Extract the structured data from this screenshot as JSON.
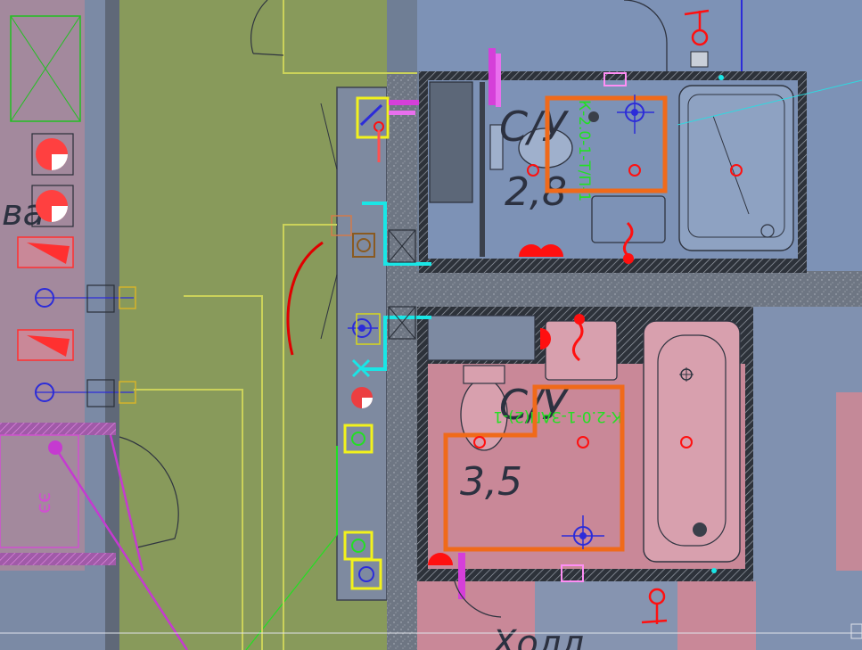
{
  "drawing": {
    "rooms": [
      {
        "id": "bath-top",
        "code": "С/У",
        "area": "2,8"
      },
      {
        "id": "bath-bottom",
        "code": "С/У",
        "area": "3,5"
      }
    ],
    "fragments": {
      "left_room": "ва",
      "left_pink": "ээ",
      "hall": "Холл"
    },
    "tags": {
      "top": "К-2.0-1-Т/П-1",
      "bottom": "К-2.0-1-ЗАП(2)-1"
    },
    "colors": {
      "background": "#6f7e95",
      "room_blue": "#7d92b6",
      "room_pink": "#c98898",
      "corridor_green": "#889a5b",
      "wall": "#3f4651",
      "highlight_orange": "#f06a1a",
      "highlight_yellow": "#f2f21c",
      "symbol_red": "#ff1010",
      "symbol_blue": "#2c2cd9",
      "pipe_cyan": "#19e6e6",
      "annotation_green": "#22e022",
      "magenta_line": "#c53ad0"
    }
  }
}
